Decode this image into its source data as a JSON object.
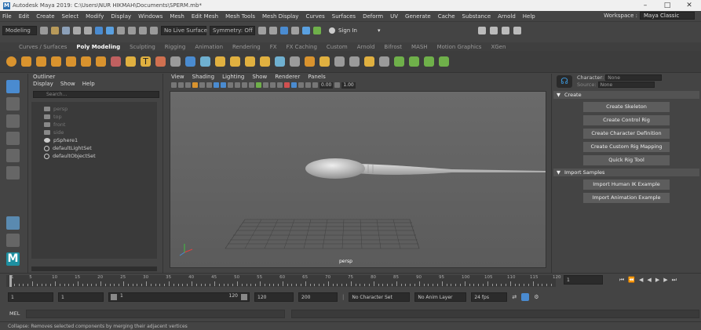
{
  "app": {
    "title": "Autodesk Maya 2019: C:\\Users\\NUR HIKMAH\\Documents\\SPERM.mb*",
    "window_controls": [
      "minimize-icon",
      "maximize-icon",
      "close-icon"
    ]
  },
  "menubar": {
    "items": [
      "File",
      "Edit",
      "Create",
      "Select",
      "Modify",
      "Display",
      "Windows",
      "Mesh",
      "Edit Mesh",
      "Mesh Tools",
      "Mesh Display",
      "Curves",
      "Surfaces",
      "Deform",
      "UV",
      "Generate",
      "Cache",
      "Substance",
      "Arnold",
      "Help"
    ],
    "workspace_label": "Workspace :",
    "workspace_value": "Maya Classic"
  },
  "statusline": {
    "menuset": "Modeling",
    "live_surface": "No Live Surface",
    "symmetry": "Symmetry: Off",
    "sign_in": "Sign In"
  },
  "shelf": {
    "tabs": [
      "Curves / Surfaces",
      "Poly Modeling",
      "Sculpting",
      "Rigging",
      "Animation",
      "Rendering",
      "FX",
      "FX Caching",
      "Custom",
      "Arnold",
      "Bifrost",
      "MASH",
      "Motion Graphics",
      "XGen"
    ],
    "active_tab": "Poly Modeling"
  },
  "outliner": {
    "title": "Outliner",
    "menus": [
      "Display",
      "Show",
      "Help"
    ],
    "search_placeholder": "Search...",
    "items": [
      {
        "label": "persp",
        "type": "camera",
        "dim": true
      },
      {
        "label": "top",
        "type": "camera",
        "dim": true
      },
      {
        "label": "front",
        "type": "camera",
        "dim": true
      },
      {
        "label": "side",
        "type": "camera",
        "dim": true
      },
      {
        "label": "pSphere1",
        "type": "mesh",
        "dim": false
      },
      {
        "label": "defaultLightSet",
        "type": "set",
        "dim": false
      },
      {
        "label": "defaultObjectSet",
        "type": "set",
        "dim": false
      }
    ]
  },
  "viewport": {
    "menus": [
      "View",
      "Shading",
      "Lighting",
      "Show",
      "Renderer",
      "Panels"
    ],
    "near": "0.00",
    "far": "1.00",
    "camera_label": "persp"
  },
  "character_panel": {
    "character_label": "Character:",
    "character_value": "None",
    "source_label": "Source:",
    "source_value": "None",
    "create_section": "Create",
    "create_buttons": [
      "Create Skeleton",
      "Create Control Rig",
      "Create Character Definition",
      "Create Custom Rig Mapping",
      "Quick Rig Tool"
    ],
    "samples_section": "Import Samples",
    "sample_buttons": [
      "Import Human IK Example",
      "Import Animation Example"
    ]
  },
  "timeslider": {
    "ticks": [
      "1",
      "5",
      "10",
      "15",
      "20",
      "25",
      "30",
      "35",
      "40",
      "45",
      "50",
      "55",
      "60",
      "65",
      "70",
      "75",
      "80",
      "85",
      "90",
      "95",
      "100",
      "105",
      "110",
      "115",
      "120"
    ],
    "current_frame": "1"
  },
  "range": {
    "start": "1",
    "playback_start": "1",
    "range_start_field": "1",
    "range_end_field": "120",
    "playback_end": "120",
    "end": "200",
    "character_set": "No Character Set",
    "anim_layer": "No Anim Layer",
    "fps": "24 fps"
  },
  "mel": {
    "label": "MEL"
  },
  "help_line": "Collapse: Removes selected components by merging their adjacent vertices"
}
